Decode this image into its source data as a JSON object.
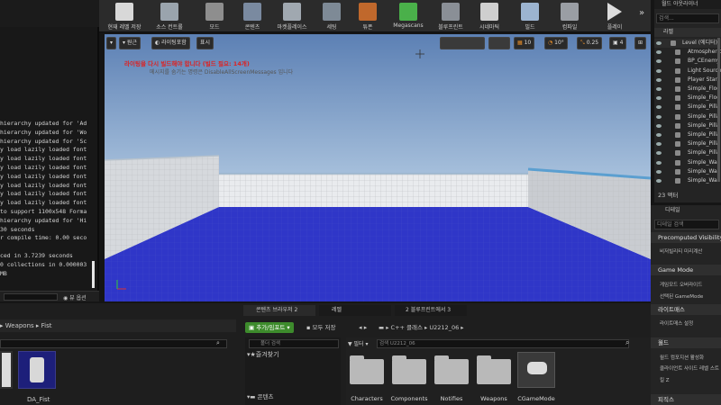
{
  "toolbar": {
    "buttons": [
      {
        "label": "현재 레벨 저장"
      },
      {
        "label": "소스 컨트롤"
      },
      {
        "label": "모드"
      },
      {
        "label": "콘텐츠"
      },
      {
        "label": "마켓플레이스"
      },
      {
        "label": "세팅"
      },
      {
        "label": "튜폰"
      },
      {
        "label": "Megascans"
      },
      {
        "label": "블루프린트"
      },
      {
        "label": "시네마틱"
      },
      {
        "label": "빌드"
      },
      {
        "label": "컴파일"
      },
      {
        "label": "플레이"
      }
    ],
    "overflow": "»"
  },
  "log": {
    "lines": [
      "hierarchy updated for 'Ad",
      "hierarchy updated for 'Wo",
      "hierarchy updated for 'Sc",
      "y load lazily loaded font",
      "y load lazily loaded font",
      "y load lazily loaded font",
      "y load lazily loaded font",
      "y load lazily loaded font",
      "y load lazily loaded font",
      "y load lazily loaded font",
      "to support 1100x548 Forma",
      "hierarchy updated for 'Hi",
      "30 seconds",
      "r compile time: 0.00 seco",
      "",
      "ced in 3.7239 seconds",
      "0 collections in 0.000003",
      "MB"
    ],
    "view_options": "뷰 옵션"
  },
  "viewport": {
    "perspective": "원근",
    "lighting": "라이팅포함",
    "show": "표시",
    "warning_title": "라이팅을 다시 빌드해야 합니다 (빌드 필요: 14개)",
    "warning_sub": "메시지를 숨기는 명령은 DisableAllScreenMessages 입니다",
    "grid_snap": "10",
    "rot_snap": "10°",
    "scale_snap": "0.25",
    "cam_speed": "4"
  },
  "outliner": {
    "title": "월드 아웃라이너",
    "search_placeholder": "검색...",
    "col_label": "라벨",
    "items": [
      "Level (에디터)",
      "Atmospheric",
      "BP_CEnemy",
      "Light Source",
      "Player Start",
      "Simple_Floo",
      "Simple_Floo",
      "Simple_Pilla",
      "Simple_Pilla",
      "Simple_Pilla",
      "Simple_Pilla",
      "Simple_Pilla",
      "Simple_Pilla",
      "Simple_Wall",
      "Simple_Wall",
      "Simple_Wall"
    ],
    "count": "23 액터"
  },
  "details": {
    "title": "디테일",
    "search_placeholder": "디테일 검색",
    "sections": [
      {
        "header": "Precomputed Visibility",
        "sub": "비저빌리티 미리계산"
      },
      {
        "header": "Game Mode",
        "sub": "게임모드 오버라이드"
      },
      {
        "header": "",
        "sub": "선택된 GameMode"
      },
      {
        "header": "라이트매스",
        "sub": "라이트매스 설정"
      },
      {
        "header": "월드",
        "sub": "월드 컴포지션 활성화"
      },
      {
        "header": "",
        "sub": "클라이언트 사이드 레벨 스트"
      },
      {
        "header": "",
        "sub": "킬 Z"
      },
      {
        "header": "피직스",
        "sub": ""
      }
    ]
  },
  "bottom": {
    "left_path": [
      "Weapons",
      "Fist"
    ],
    "left_assets": [
      "",
      "DA_Fist"
    ],
    "tabs": [
      "콘텐츠 브라우저 2",
      "레벨",
      "2 블루프린트에서 3"
    ],
    "add_import": "추가/임포트",
    "save_all": "모두 저장",
    "path": [
      "C++ 클래스",
      "U2212_06"
    ],
    "filter": "필터",
    "search_placeholder": "검색 U2212_06",
    "tree_search": "폴더 검색",
    "favorites": "즐겨찾기",
    "content_label": "콘텐츠",
    "folders": [
      "Characters",
      "Components",
      "Notifies",
      "Weapons",
      "CGameMode"
    ]
  }
}
